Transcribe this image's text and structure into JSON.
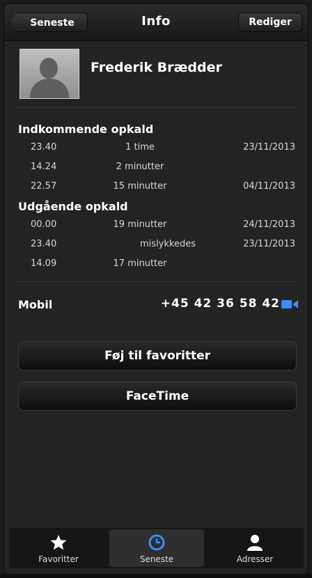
{
  "navbar": {
    "back_label": "Seneste",
    "title": "Info",
    "edit_label": "Rediger"
  },
  "contact": {
    "name": "Frederik Brædder"
  },
  "incoming": {
    "title": "Indkommende opkald",
    "calls": [
      {
        "time": "23.40",
        "duration": "1 time",
        "date": "23/11/2013"
      },
      {
        "time": "14.24",
        "duration": "2 minutter",
        "date": ""
      },
      {
        "time": "22.57",
        "duration": "15 minutter",
        "date": "04/11/2013"
      }
    ]
  },
  "outgoing": {
    "title": "Udgående opkald",
    "calls": [
      {
        "time": "00.00",
        "duration": "19 minutter",
        "date": "24/11/2013"
      },
      {
        "time": "23.40",
        "duration": "mislykkedes",
        "date": "23/11/2013"
      },
      {
        "time": "14.09",
        "duration": "17 minutter",
        "date": ""
      }
    ]
  },
  "phone": {
    "label": "Mobil",
    "number": "+45 42 36 58 42",
    "icon": "video-camera-icon",
    "icon_color": "#3a8ef6"
  },
  "actions": {
    "favorite_label": "Føj til favoritter",
    "facetime_label": "FaceTime"
  },
  "tabbar": {
    "tabs": [
      {
        "label": "Favoritter",
        "icon": "star-icon",
        "active": false
      },
      {
        "label": "Seneste",
        "icon": "clock-icon",
        "active": true
      },
      {
        "label": "Adresser",
        "icon": "person-icon",
        "active": false
      }
    ],
    "active_color": "#3a8ef6"
  }
}
